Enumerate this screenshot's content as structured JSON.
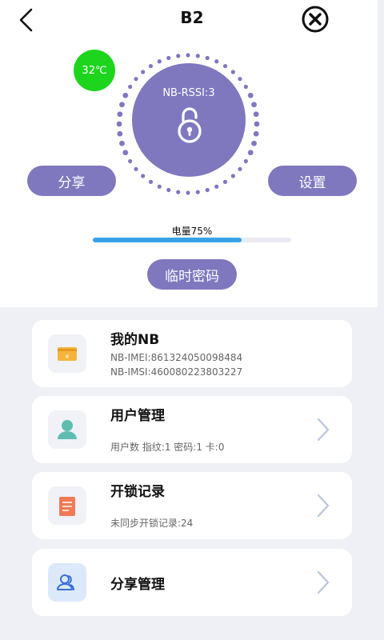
{
  "header": {
    "title": "B2"
  },
  "lock": {
    "temperature": "32℃",
    "rssi": "NB-RSSI:3"
  },
  "actions": {
    "share_label": "分享",
    "settings_label": "设置",
    "temp_password_label": "临时密码"
  },
  "battery": {
    "label": "电量75%",
    "level_percent": 75
  },
  "cards": [
    {
      "title": "我的NB",
      "lines": [
        "NB-IMEI:861324050098484",
        "NB-IMSI:460080223803227"
      ],
      "icon": "wallet-icon"
    },
    {
      "title": "用户管理",
      "lines": [
        "用户数 指纹:1 密码:1 卡:0"
      ],
      "icon": "user-icon"
    },
    {
      "title": "开锁记录",
      "lines": [
        "未同步开锁记录:24"
      ],
      "icon": "log-icon"
    },
    {
      "title": "分享管理",
      "lines": [],
      "icon": "users-icon"
    }
  ],
  "colors": {
    "accent": "#7f78bf",
    "temperature": "#1ed51e",
    "battery": "#3aa1e8",
    "background": "#eef0f5"
  }
}
